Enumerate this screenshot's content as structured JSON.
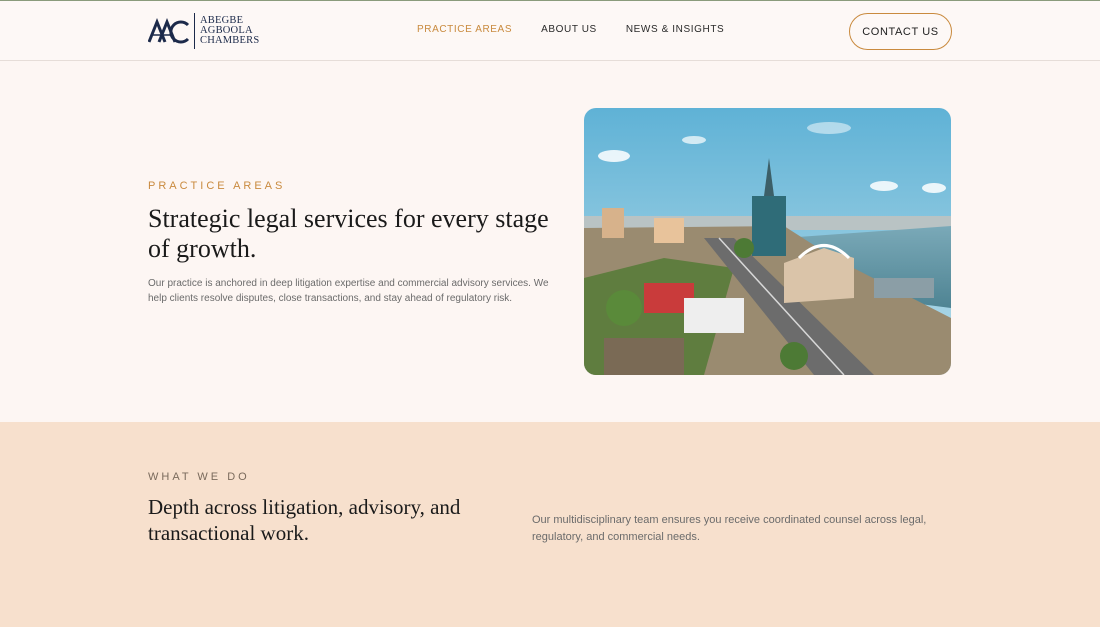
{
  "brand": {
    "monogram": "AAC",
    "name_lines": [
      "ABEGBE",
      "AGBOOLA",
      "CHAMBERS"
    ],
    "color": "#1c2a4a"
  },
  "nav": {
    "items": [
      {
        "label": "PRACTICE AREAS",
        "active": true
      },
      {
        "label": "ABOUT US",
        "active": false
      },
      {
        "label": "NEWS & INSIGHTS",
        "active": false
      }
    ],
    "contact_label": "CONTACT US"
  },
  "hero": {
    "eyebrow": "PRACTICE AREAS",
    "title": "Strategic legal services for every stage of growth.",
    "body": "Our practice is anchored in deep litigation expertise and commercial advisory services. We help clients resolve disputes, close transactions, and stay ahead of regulatory risk."
  },
  "what_we_do": {
    "eyebrow": "WHAT WE DO",
    "title": "Depth across litigation, advisory, and transactional work.",
    "body": "Our multidisciplinary team ensures you receive coordinated counsel across legal, regulatory, and commercial needs."
  },
  "colors": {
    "accent": "#c98a3e",
    "hero_bg": "#fdf6f3",
    "section_bg": "#f7e0cd"
  }
}
